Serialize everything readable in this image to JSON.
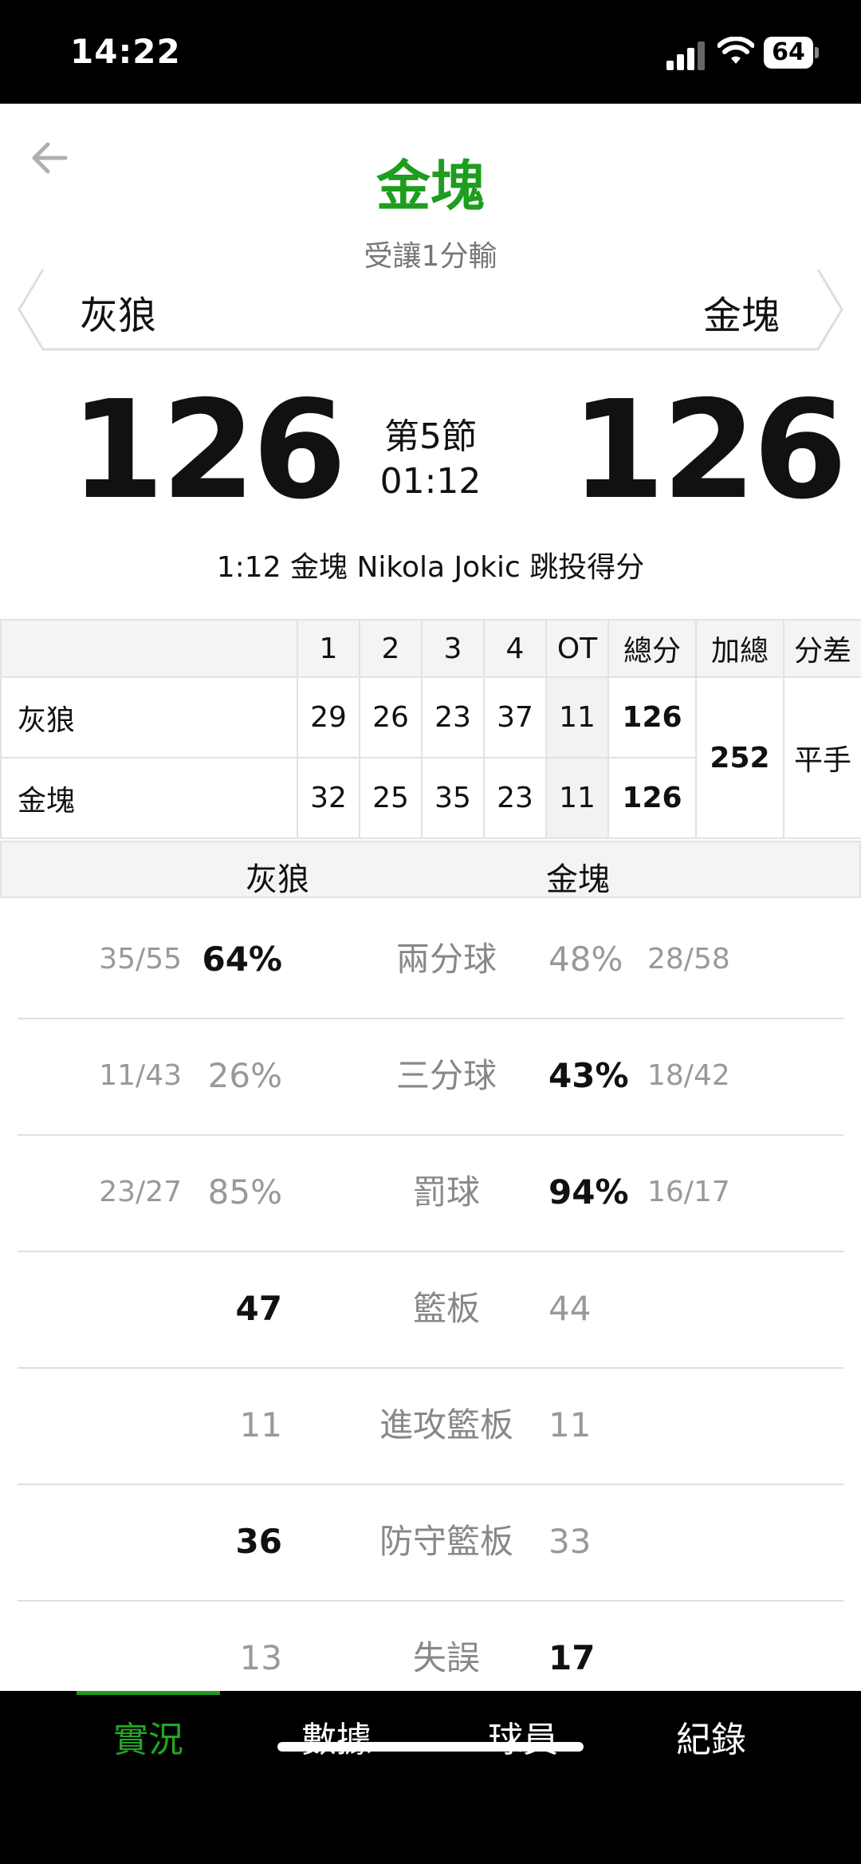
{
  "status_bar": {
    "time": "14:22",
    "battery": "64"
  },
  "header": {
    "title": "金塊",
    "handicap_text": "受讓1分輸",
    "away_team": "灰狼",
    "home_team": "金塊"
  },
  "score": {
    "away": "126",
    "home": "126",
    "period": "第5節",
    "clock": "01:12",
    "last_play": "1:12 金塊 Nikola Jokic 跳投得分"
  },
  "linescore": {
    "headers": [
      "",
      "1",
      "2",
      "3",
      "4",
      "OT",
      "總分",
      "加總",
      "分差"
    ],
    "rows": [
      {
        "team": "灰狼",
        "q": [
          "29",
          "26",
          "23",
          "37"
        ],
        "ot": "11",
        "total": "126"
      },
      {
        "team": "金塊",
        "q": [
          "32",
          "25",
          "35",
          "23"
        ],
        "ot": "11",
        "total": "126"
      }
    ],
    "combined": "252",
    "diff": "平手"
  },
  "compare": {
    "away_team": "灰狼",
    "home_team": "金塊",
    "rows": [
      {
        "label": "兩分球",
        "away_frac": "35/55",
        "away": "64%",
        "home": "48%",
        "home_frac": "28/58"
      },
      {
        "label": "三分球",
        "away_frac": "11/43",
        "away": "26%",
        "home": "43%",
        "home_frac": "18/42"
      },
      {
        "label": "罰球",
        "away_frac": "23/27",
        "away": "85%",
        "home": "94%",
        "home_frac": "16/17"
      },
      {
        "label": "籃板",
        "away": "47",
        "home": "44"
      },
      {
        "label": "進攻籃板",
        "away": "11",
        "home": "11"
      },
      {
        "label": "防守籃板",
        "away": "36",
        "home": "33"
      },
      {
        "label": "失誤",
        "away": "13",
        "home": "17"
      }
    ]
  },
  "tabs": [
    "實況",
    "數據",
    "球員",
    "紀錄"
  ],
  "colors": {
    "accent": "#1e9d1e",
    "header_bg": "#f4f4f4",
    "tabbar_bg": "#000000"
  }
}
